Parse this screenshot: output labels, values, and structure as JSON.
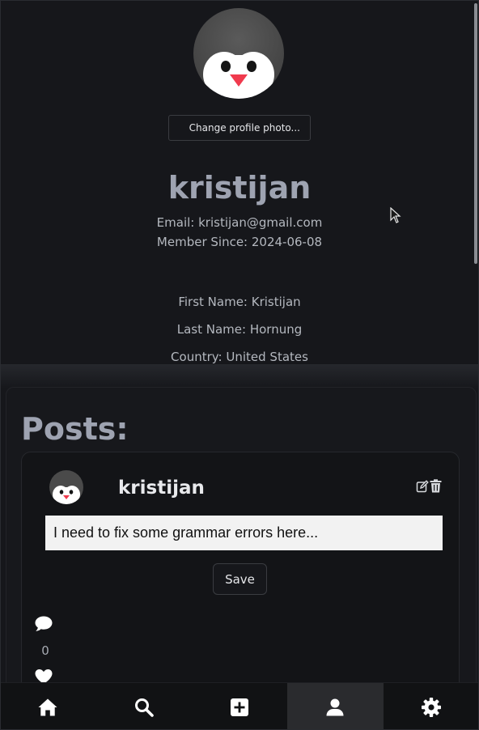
{
  "profile": {
    "username": "kristijan",
    "change_photo_label": "Change profile photo...",
    "email_line": "Email: kristijan@gmail.com",
    "member_since_line": "Member Since: 2024-06-08",
    "first_name_line": "First Name: Kristijan",
    "last_name_line": "Last Name: Hornung",
    "country_line": "Country: United States"
  },
  "posts": {
    "title": "Posts:",
    "items": [
      {
        "username": "kristijan",
        "edit_value": "I need to fix some grammar errors here...",
        "save_label": "Save",
        "comment_count": "0"
      }
    ]
  },
  "nav": {
    "items": [
      {
        "icon": "home-icon",
        "active": false
      },
      {
        "icon": "search-icon",
        "active": false
      },
      {
        "icon": "add-post-icon",
        "active": false
      },
      {
        "icon": "profile-icon",
        "active": true
      },
      {
        "icon": "settings-icon",
        "active": false
      }
    ]
  },
  "colors": {
    "background": "#16171b",
    "heading": "#9ea3b1",
    "nav_active": "#2a2b2e"
  }
}
